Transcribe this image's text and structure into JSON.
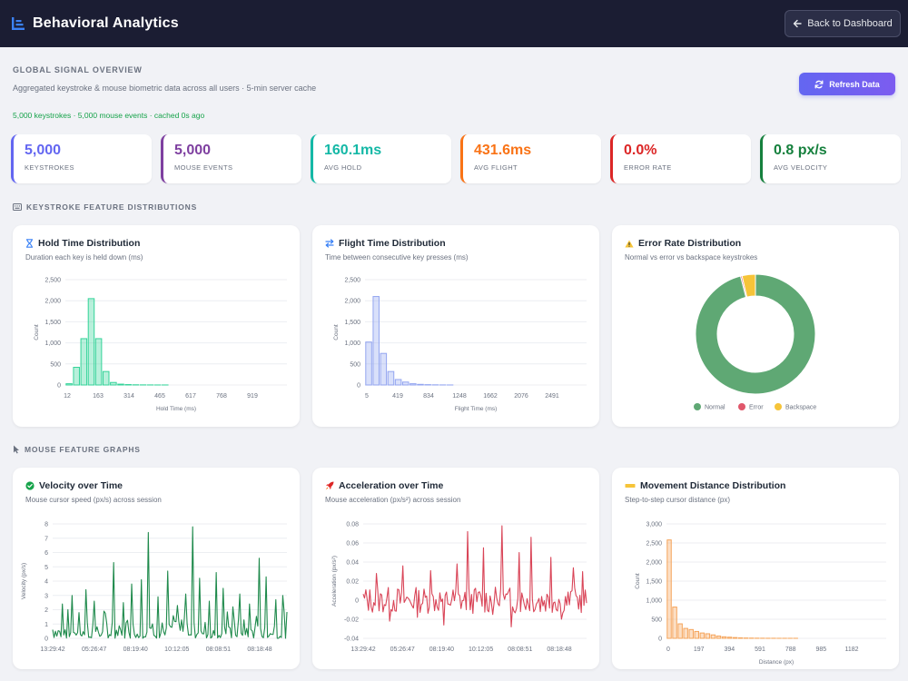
{
  "header": {
    "title": "Behavioral Analytics",
    "back_label": "Back to Dashboard"
  },
  "overview": {
    "title": "GLOBAL SIGNAL OVERVIEW",
    "subtitle": "Aggregated keystroke & mouse biometric data across all users  ·  5-min server cache",
    "status": "5,000 keystrokes · 5,000 mouse events · cached 0s ago",
    "refresh_label": "Refresh Data"
  },
  "stats": [
    {
      "value": "5,000",
      "label": "KEYSTROKES",
      "color": "#6366f1"
    },
    {
      "value": "5,000",
      "label": "MOUSE EVENTS",
      "color": "#7e3fa0"
    },
    {
      "value": "160.1ms",
      "label": "AVG HOLD",
      "color": "#14b8a6"
    },
    {
      "value": "431.6ms",
      "label": "AVG FLIGHT",
      "color": "#f97316"
    },
    {
      "value": "0.0%",
      "label": "ERROR RATE",
      "color": "#dc2626"
    },
    {
      "value": "0.8 px/s",
      "label": "AVG VELOCITY",
      "color": "#15803d"
    }
  ],
  "sections": {
    "keystroke": "KEYSTROKE FEATURE DISTRIBUTIONS",
    "mouse": "MOUSE FEATURE GRAPHS"
  },
  "cards": {
    "hold": {
      "title": "Hold Time Distribution",
      "sub": "Duration each key is held down (ms)"
    },
    "flight": {
      "title": "Flight Time Distribution",
      "sub": "Time between consecutive key presses (ms)"
    },
    "error": {
      "title": "Error Rate Distribution",
      "sub": "Normal vs error vs backspace keystrokes"
    },
    "velocity": {
      "title": "Velocity over Time",
      "sub": "Mouse cursor speed (px/s) across session"
    },
    "accel": {
      "title": "Acceleration over Time",
      "sub": "Mouse acceleration (px/s²) across session"
    },
    "distance": {
      "title": "Movement Distance Distribution",
      "sub": "Step-to-step cursor distance (px)"
    }
  },
  "chart_data": [
    {
      "id": "hold",
      "type": "bar",
      "color": "#34d399",
      "ylabel": "Count",
      "xlabel": "Hold Time (ms)",
      "ylim": [
        0,
        2500
      ],
      "yticks": [
        0,
        500,
        1000,
        1500,
        2000,
        2500
      ],
      "xtick_labels": [
        "12",
        "163",
        "314",
        "465",
        "617",
        "768",
        "919"
      ],
      "values": [
        30,
        420,
        1100,
        2050,
        1100,
        320,
        60,
        20,
        10,
        5,
        3,
        2,
        1,
        1,
        0,
        0,
        0,
        0,
        0,
        0,
        0,
        0,
        0,
        0,
        0,
        0,
        0,
        0,
        0,
        0
      ]
    },
    {
      "id": "flight",
      "type": "bar",
      "color": "#93a5f0",
      "ylabel": "Count",
      "xlabel": "Flight Time (ms)",
      "ylim": [
        0,
        2500
      ],
      "yticks": [
        0,
        500,
        1000,
        1500,
        2000,
        2500
      ],
      "xtick_labels": [
        "5",
        "419",
        "834",
        "1248",
        "1662",
        "2076",
        "2491"
      ],
      "values": [
        1020,
        2100,
        750,
        320,
        130,
        70,
        30,
        15,
        8,
        4,
        2,
        1,
        0,
        0,
        0,
        0,
        0,
        0,
        0,
        0,
        0,
        0,
        0,
        0,
        0,
        0,
        0,
        0,
        0,
        0
      ]
    },
    {
      "id": "error",
      "type": "pie",
      "labels": [
        "Normal",
        "Error",
        "Backspace"
      ],
      "values": [
        96,
        0.4,
        3.6
      ],
      "colors": [
        "#5fa874",
        "#e0576b",
        "#f6c439"
      ]
    },
    {
      "id": "velocity",
      "type": "line",
      "color": "#1f8a4c",
      "ylabel": "Velocity (px/s)",
      "ylim": [
        0,
        8
      ],
      "yticks": [
        0,
        1,
        2,
        3,
        4,
        5,
        6,
        7,
        8
      ],
      "xtick_labels": [
        "13:29:42",
        "05:26:47",
        "08:19:40",
        "10:12:05",
        "08:08:51",
        "08:18:48"
      ],
      "spikes": [
        [
          0.04,
          2.4
        ],
        [
          0.08,
          3.0
        ],
        [
          0.11,
          1.8
        ],
        [
          0.14,
          3.4
        ],
        [
          0.18,
          2.6
        ],
        [
          0.22,
          1.9
        ],
        [
          0.26,
          5.3
        ],
        [
          0.3,
          2.5
        ],
        [
          0.34,
          3.8
        ],
        [
          0.38,
          4.1
        ],
        [
          0.41,
          7.4
        ],
        [
          0.45,
          2.9
        ],
        [
          0.49,
          4.7
        ],
        [
          0.53,
          2.3
        ],
        [
          0.57,
          3.1
        ],
        [
          0.6,
          7.8
        ],
        [
          0.63,
          4.2
        ],
        [
          0.67,
          2.6
        ],
        [
          0.7,
          4.6
        ],
        [
          0.73,
          3.5
        ],
        [
          0.77,
          2.2
        ],
        [
          0.8,
          3.1
        ],
        [
          0.84,
          2.4
        ],
        [
          0.88,
          5.6
        ],
        [
          0.91,
          4.3
        ],
        [
          0.95,
          2.7
        ],
        [
          0.98,
          3.0
        ]
      ]
    },
    {
      "id": "accel",
      "type": "line",
      "color": "#d94457",
      "ylabel": "Acceleration (px/s²)",
      "ylim": [
        -0.04,
        0.08
      ],
      "yticks": [
        -0.04,
        -0.02,
        0,
        0.02,
        0.04,
        0.06,
        0.08
      ],
      "ytick_labels": [
        "-0.04",
        "-0.02",
        "0",
        "0.02",
        "0.04",
        "0.06",
        "0.08"
      ],
      "xtick_labels": [
        "13:29:42",
        "05:26:47",
        "08:19:40",
        "10:12:05",
        "08:08:51",
        "08:18:48"
      ],
      "spikes": [
        [
          0.06,
          0.028
        ],
        [
          0.12,
          -0.022
        ],
        [
          0.18,
          0.036
        ],
        [
          0.24,
          -0.018
        ],
        [
          0.3,
          0.031
        ],
        [
          0.36,
          -0.026
        ],
        [
          0.42,
          0.038
        ],
        [
          0.47,
          0.072
        ],
        [
          0.5,
          -0.036
        ],
        [
          0.54,
          0.055
        ],
        [
          0.58,
          -0.015
        ],
        [
          0.62,
          0.078
        ],
        [
          0.66,
          -0.028
        ],
        [
          0.7,
          0.05
        ],
        [
          0.75,
          0.066
        ],
        [
          0.79,
          -0.012
        ],
        [
          0.84,
          0.045
        ],
        [
          0.89,
          -0.02
        ],
        [
          0.94,
          0.034
        ],
        [
          0.98,
          0.03
        ]
      ]
    },
    {
      "id": "distance",
      "type": "bar",
      "color": "#f5a45a",
      "ylabel": "Count",
      "xlabel": "Distance (px)",
      "ylim": [
        0,
        3000
      ],
      "yticks": [
        0,
        500,
        1000,
        1500,
        2000,
        2500,
        3000
      ],
      "xtick_labels": [
        "0",
        "197",
        "394",
        "591",
        "788",
        "985",
        "1182"
      ],
      "values": [
        2580,
        820,
        380,
        260,
        230,
        180,
        140,
        120,
        90,
        60,
        40,
        30,
        20,
        12,
        8,
        6,
        4,
        3,
        2,
        2,
        1,
        1,
        1,
        1,
        0,
        0,
        0,
        0,
        0,
        0,
        0,
        0,
        0,
        0,
        0,
        0,
        0,
        0,
        0,
        0
      ]
    }
  ]
}
